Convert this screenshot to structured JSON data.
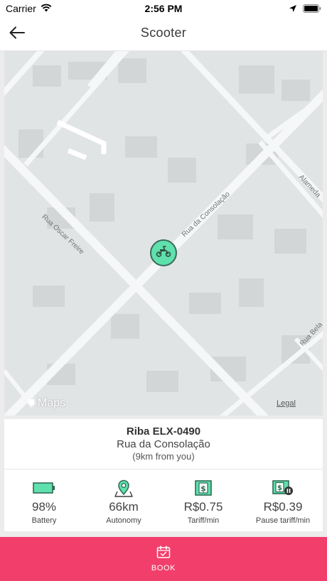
{
  "status_bar": {
    "carrier": "Carrier",
    "time": "2:56 PM",
    "icons": [
      "wifi-icon",
      "location-arrow-icon",
      "battery-icon"
    ]
  },
  "nav": {
    "title": "Scooter",
    "back_icon": "arrow-left-icon"
  },
  "map": {
    "streets": [
      "Rua Oscar Freire",
      "Rua da Consolação",
      "Alameda",
      "Rua Bela"
    ],
    "provider": "Maps",
    "legal": "Legal",
    "marker_icon": "scooter-icon",
    "marker_color": "#5fe0ad"
  },
  "vehicle": {
    "name": "Riba ELX-0490",
    "street": "Rua da Consolação",
    "distance": "(9km from you)"
  },
  "stats": [
    {
      "icon": "battery-icon",
      "value": "98%",
      "label": "Battery"
    },
    {
      "icon": "map-pin-icon",
      "value": "66km",
      "label": "Autonomy"
    },
    {
      "icon": "dollar-bill-icon",
      "value": "R$0.75",
      "label": "Tariff/min"
    },
    {
      "icon": "pause-dollar-icon",
      "value": "R$0.39",
      "label": "Pause tariff/min"
    }
  ],
  "book": {
    "label": "BOOK",
    "icon": "calendar-check-icon",
    "color": "#f23e6b"
  },
  "colors": {
    "accent_green": "#3aa776",
    "accent_pink": "#f23e6b"
  }
}
